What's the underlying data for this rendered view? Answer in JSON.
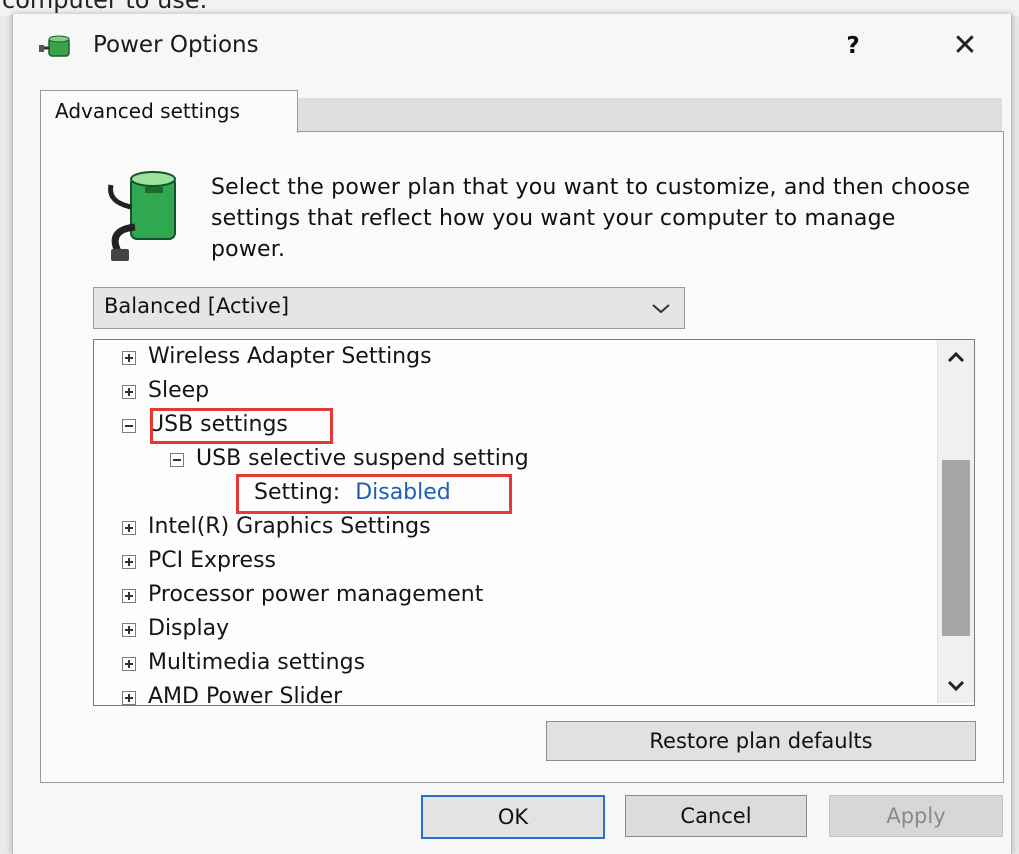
{
  "background": {
    "text": "computer to use."
  },
  "window": {
    "title": "Power Options",
    "help_label": "?",
    "close_label": "✕"
  },
  "tabs": [
    {
      "label": "Advanced settings",
      "selected": true
    }
  ],
  "description": "Select the power plan that you want to customize, and then choose settings that reflect how you want your computer to manage power.",
  "plan_select": {
    "value": "Balanced [Active]"
  },
  "tree": {
    "items": [
      {
        "label": "Wireless Adapter Settings",
        "expanded": false
      },
      {
        "label": "Sleep",
        "expanded": false
      },
      {
        "label": "USB settings",
        "expanded": true,
        "highlighted": true
      },
      {
        "label": "USB selective suspend setting",
        "expanded": true
      },
      {
        "label": "Setting:",
        "value": "Disabled",
        "highlighted": true
      },
      {
        "label": "Intel(R) Graphics Settings",
        "expanded": false
      },
      {
        "label": "PCI Express",
        "expanded": false
      },
      {
        "label": "Processor power management",
        "expanded": false
      },
      {
        "label": "Display",
        "expanded": false
      },
      {
        "label": "Multimedia settings",
        "expanded": false
      },
      {
        "label": "AMD Power Slider",
        "expanded": false
      }
    ]
  },
  "buttons": {
    "restore": "Restore plan defaults",
    "ok": "OK",
    "cancel": "Cancel",
    "apply": "Apply"
  },
  "colors": {
    "highlight_box": "#e53935",
    "setting_value": "#1d5fb8",
    "ok_focus_border": "#2a6fcc"
  },
  "icons": {
    "title": "power-options-icon",
    "plan": "battery-plug-icon",
    "dropdown": "chevron-down-icon",
    "scroll_up": "chevron-up-icon",
    "scroll_down": "chevron-down-icon"
  }
}
